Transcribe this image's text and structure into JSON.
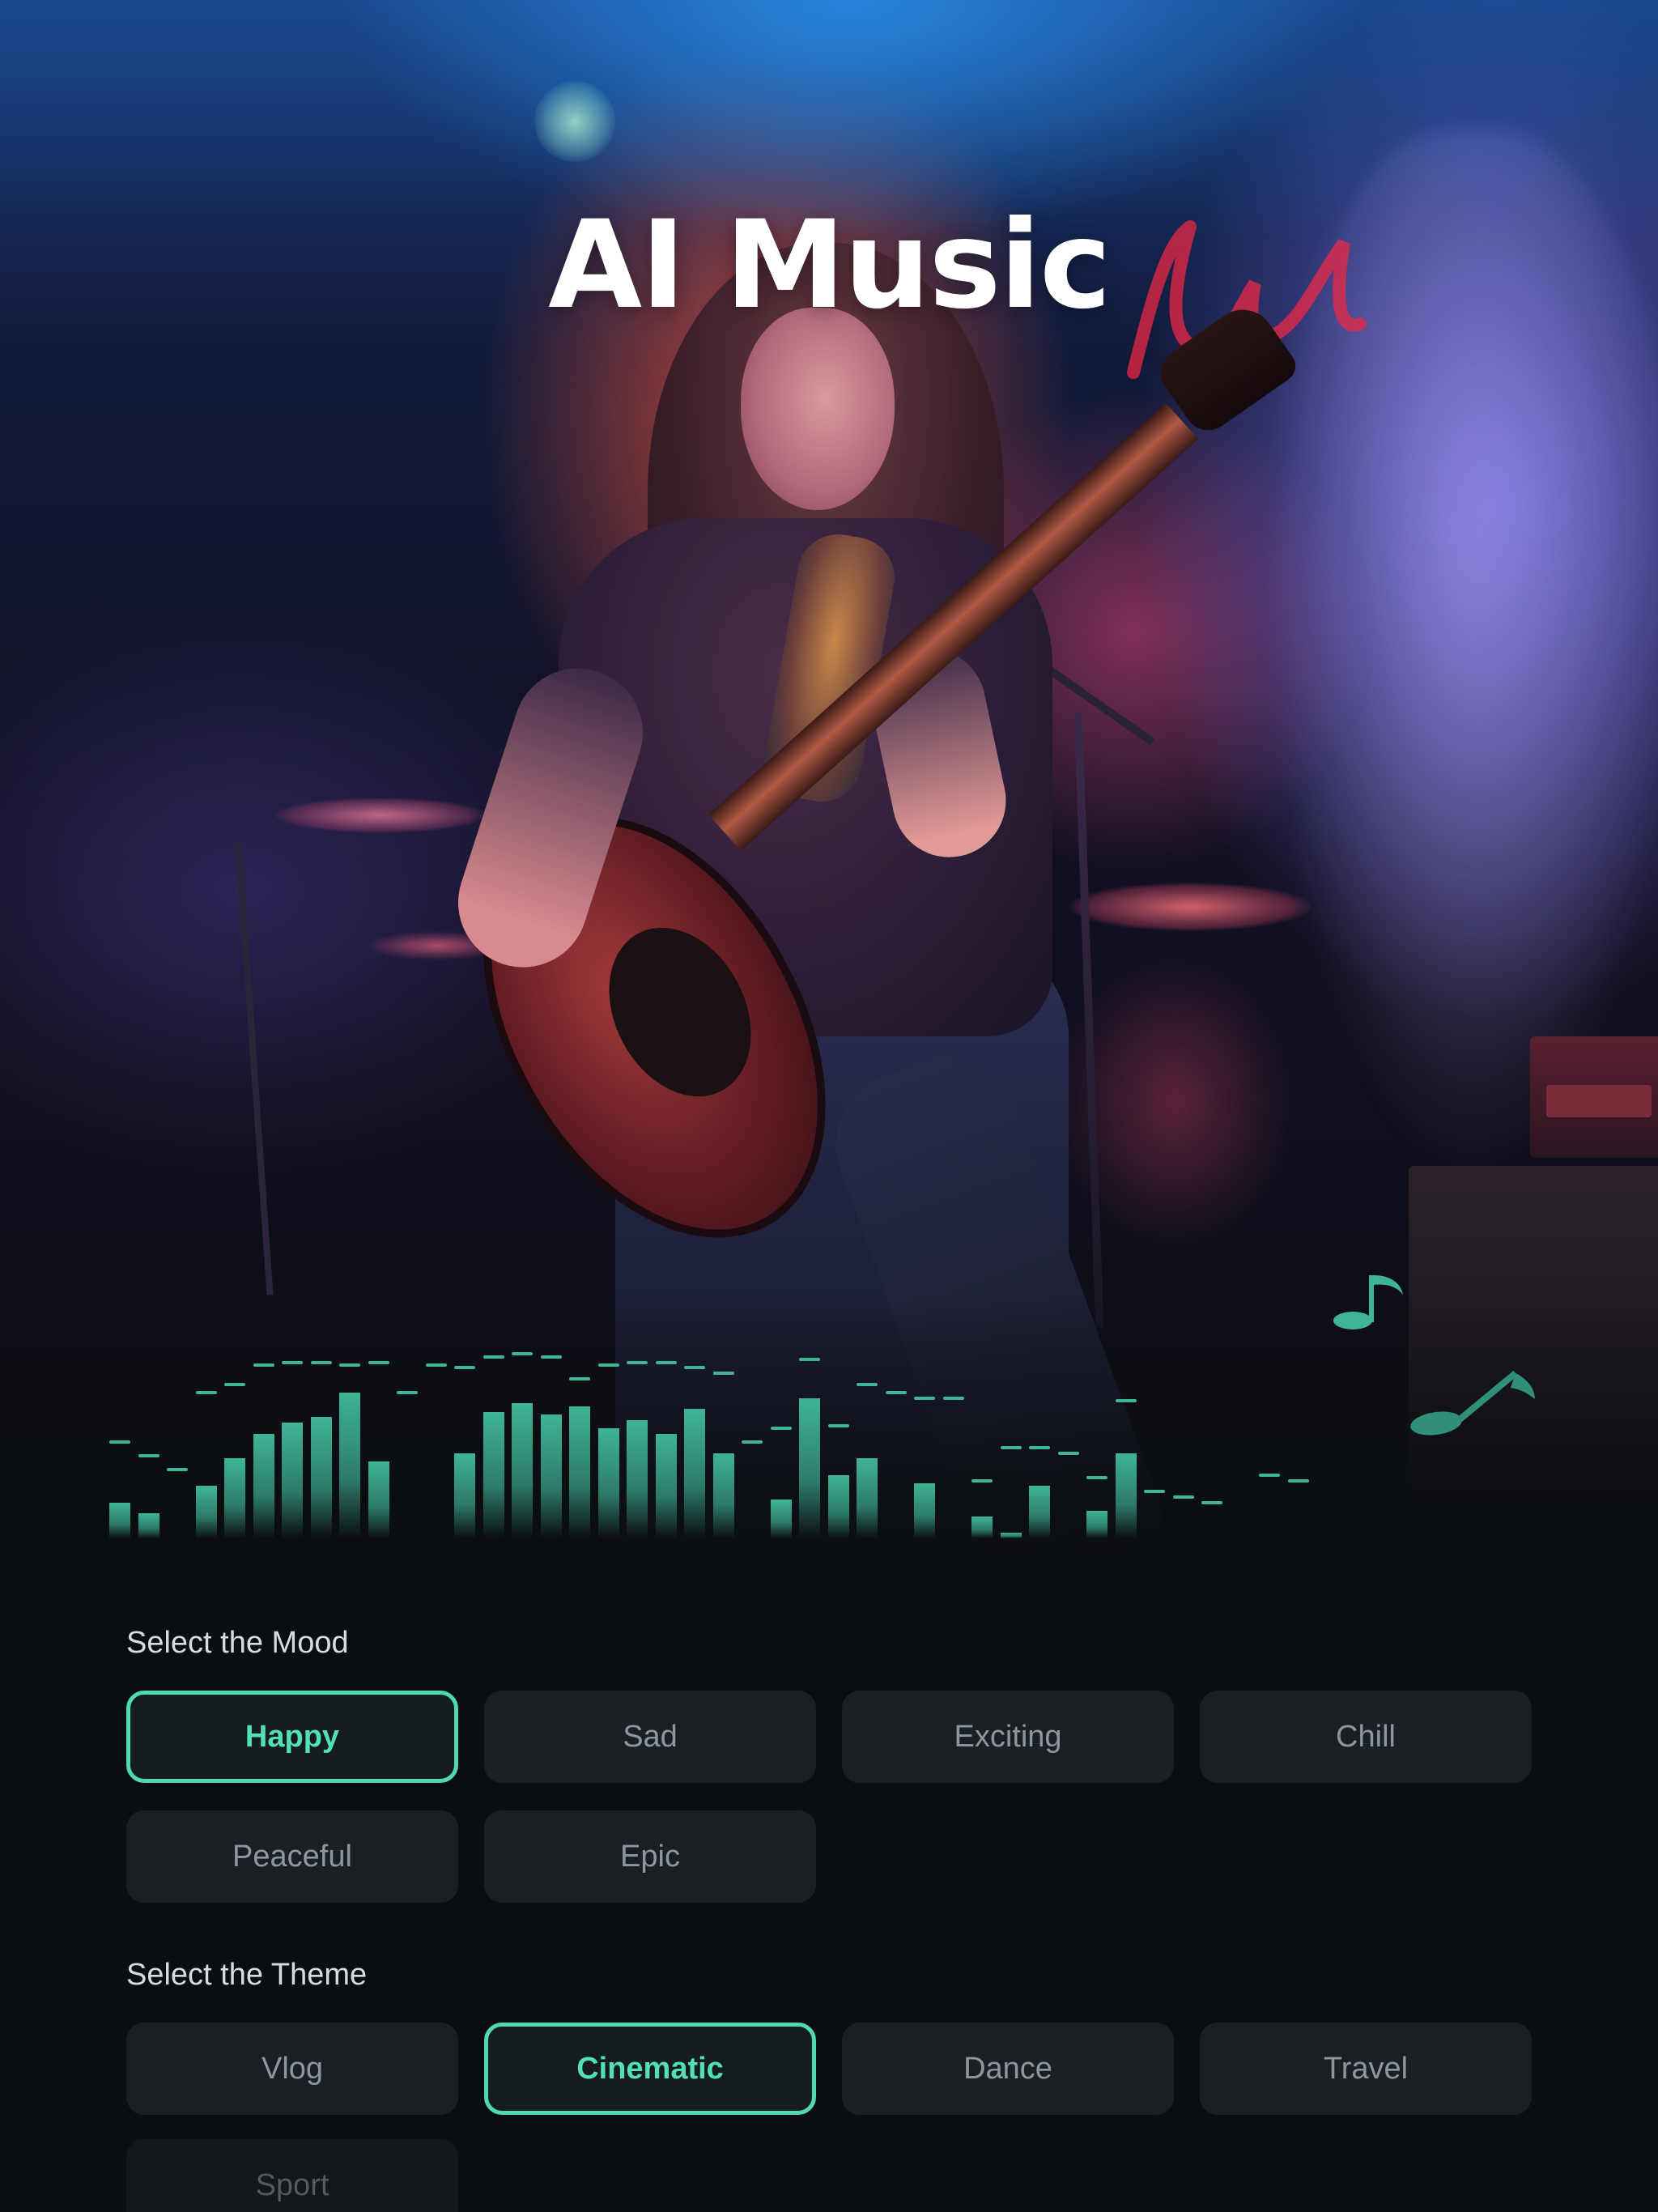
{
  "app": {
    "title": "AI Music"
  },
  "colors": {
    "accent": "#4fd9b0",
    "background": "#0b0e11",
    "chip_background": "#1a1f23",
    "chip_text": "#8f979e",
    "equalizer": "#3fb497"
  },
  "hero": {
    "image": "concert-guitarist-photo",
    "decorations": [
      "music-note-icon",
      "music-note-icon"
    ]
  },
  "mood": {
    "label": "Select the Mood",
    "options": [
      "Happy",
      "Sad",
      "Exciting",
      "Chill",
      "Peaceful",
      "Epic"
    ],
    "selected": "Happy"
  },
  "theme": {
    "label": "Select the Theme",
    "options": [
      "Vlog",
      "Cinematic",
      "Dance",
      "Travel",
      "Sport"
    ],
    "selected": "Cinematic"
  }
}
